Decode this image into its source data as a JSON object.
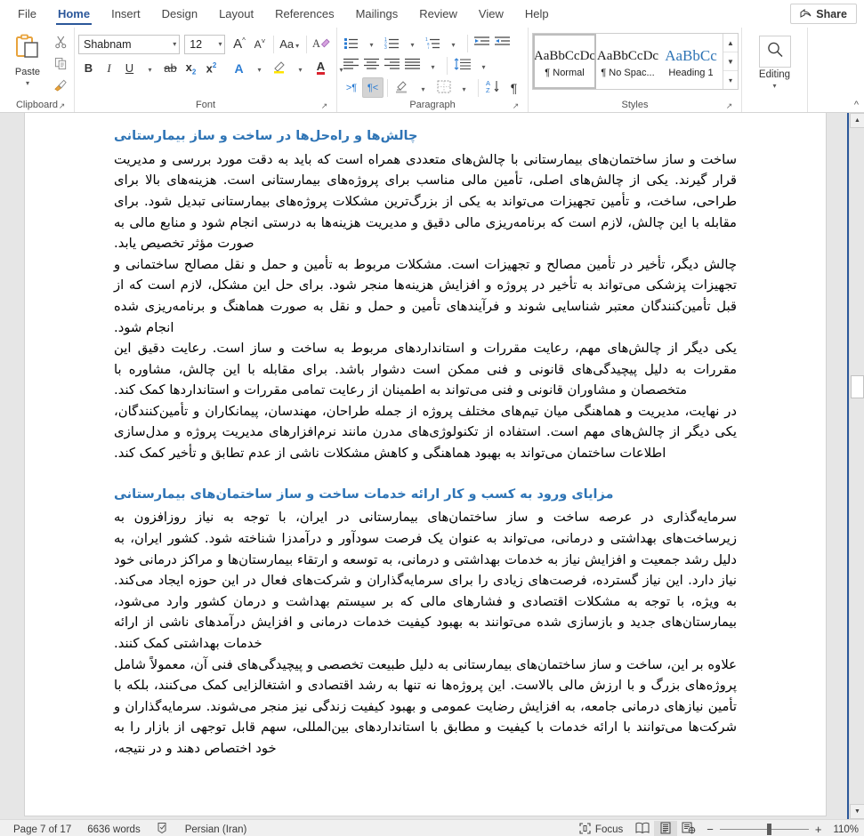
{
  "tabs": [
    {
      "label": "File",
      "active": false
    },
    {
      "label": "Home",
      "active": true
    },
    {
      "label": "Insert",
      "active": false
    },
    {
      "label": "Design",
      "active": false
    },
    {
      "label": "Layout",
      "active": false
    },
    {
      "label": "References",
      "active": false
    },
    {
      "label": "Mailings",
      "active": false
    },
    {
      "label": "Review",
      "active": false
    },
    {
      "label": "View",
      "active": false
    },
    {
      "label": "Help",
      "active": false
    }
  ],
  "share": {
    "label": "Share",
    "icon": "share-icon"
  },
  "ribbon": {
    "clipboard": {
      "group_label": "Clipboard",
      "paste_label": "Paste",
      "cut_icon": "scissors-icon",
      "copy_icon": "copy-icon",
      "format_painter_icon": "format-painter-icon"
    },
    "font": {
      "group_label": "Font",
      "font_name": "Shabnam",
      "font_size": "12",
      "grow_font_icon": "grow-font-icon",
      "shrink_font_icon": "shrink-font-icon",
      "change_case_label": "Aa",
      "clear_formatting_icon": "clear-formatting-icon",
      "bold_label": "B",
      "italic_label": "I",
      "underline_label": "U",
      "strikethrough_label": "ab",
      "subscript_label": "x",
      "superscript_label": "x",
      "text_effects_label": "A",
      "highlight_label": "highlight-icon",
      "font_color_label": "A"
    },
    "paragraph": {
      "group_label": "Paragraph",
      "bullets_icon": "bullets-icon",
      "numbering_icon": "numbering-icon",
      "multilevel_icon": "multilevel-list-icon",
      "decrease_indent_icon": "decrease-indent-icon",
      "increase_indent_icon": "increase-indent-icon",
      "align_left_icon": "align-left-icon",
      "align_center_icon": "align-center-icon",
      "align_right_icon": "align-right-icon",
      "justify_icon": "justify-icon",
      "line_spacing_icon": "line-spacing-icon",
      "ltr_label": ">¶",
      "rtl_label": "¶<",
      "shading_icon": "shading-icon",
      "borders_icon": "borders-icon",
      "sort_label": "AZ",
      "show_marks_label": "¶"
    },
    "styles": {
      "group_label": "Styles",
      "items": [
        {
          "preview": "AaBbCcDc",
          "name": "¶ Normal",
          "selected": true,
          "heading": false
        },
        {
          "preview": "AaBbCcDc",
          "name": "¶ No Spac...",
          "selected": false,
          "heading": false
        },
        {
          "preview": "AaBbCc",
          "name": "Heading 1",
          "selected": false,
          "heading": true
        }
      ]
    },
    "editing": {
      "group_label": "Editing",
      "label": "Editing",
      "icon": "magnifier-icon"
    },
    "collapse_icon": "chevron-up-icon"
  },
  "document": {
    "blocks": [
      {
        "type": "heading",
        "text": "چالش‌ها و راه‌حل‌ها در ساخت و ساز بیمارستانی"
      },
      {
        "type": "paragraph",
        "text": "ساخت و ساز ساختمان‌های بیمارستانی با چالش‌های متعددی همراه است که باید به دقت مورد بررسی و مدیریت قرار گیرند. یکی از چالش‌های اصلی، تأمین مالی مناسب برای پروژه‌های بیمارستانی است. هزینه‌های بالا برای طراحی، ساخت، و تأمین تجهیزات می‌تواند به یکی از بزرگ‌ترین مشکلات پروژه‌های بیمارستانی تبدیل شود. برای مقابله با این چالش، لازم است که برنامه‌ریزی مالی دقیق و مدیریت هزینه‌ها به درستی انجام شود و منابع مالی به صورت مؤثر تخصیص یابد."
      },
      {
        "type": "paragraph",
        "text": "چالش دیگر، تأخیر در تأمین مصالح و تجهیزات است. مشکلات مربوط به تأمین و حمل و نقل مصالح ساختمانی و تجهیزات پزشکی می‌تواند به تأخیر در پروژه و افزایش هزینه‌ها منجر شود. برای حل این مشکل، لازم است که از قبل تأمین‌کنندگان معتبر شناسایی شوند و فرآیندهای تأمین و حمل و نقل به صورت هماهنگ و برنامه‌ریزی شده انجام شود."
      },
      {
        "type": "paragraph",
        "text": "یکی دیگر از چالش‌های مهم، رعایت مقررات و استانداردهای مربوط به ساخت و ساز است. رعایت دقیق این مقررات به دلیل پیچیدگی‌های قانونی و فنی ممکن است دشوار باشد. برای مقابله با این چالش، مشاوره با متخصصان و مشاوران قانونی و فنی می‌تواند به اطمینان از رعایت تمامی مقررات و استانداردها کمک کند."
      },
      {
        "type": "paragraph",
        "text": "در نهایت، مدیریت و هماهنگی میان تیم‌های مختلف پروژه از جمله طراحان، مهندسان، پیمانکاران و تأمین‌کنندگان، یکی دیگر از چالش‌های مهم است. استفاده از تکنولوژی‌های مدرن مانند نرم‌افزارهای مدیریت پروژه و مدل‌سازی اطلاعات ساختمان می‌تواند به بهبود هماهنگی و کاهش مشکلات ناشی از عدم تطابق و تأخیر کمک کند."
      },
      {
        "type": "heading",
        "spaced": true,
        "text": "مزایای ورود به کسب و کار ارائه خدمات ساخت و ساز ساختمان‌های بیمارستانی"
      },
      {
        "type": "paragraph",
        "text": "سرمایه‌گذاری در عرصه ساخت و ساز ساختمان‌های بیمارستانی در ایران، با توجه به نیاز روزافزون به زیرساخت‌های بهداشتی و درمانی، می‌تواند به عنوان یک فرصت سودآور و درآمدزا شناخته شود. کشور ایران، به دلیل رشد جمعیت و افزایش نیاز به خدمات بهداشتی و درمانی، به توسعه و ارتقاء بیمارستان‌ها و مراکز درمانی خود نیاز دارد. این نیاز گسترده، فرصت‌های زیادی را برای سرمایه‌گذاران و شرکت‌های فعال در این حوزه ایجاد می‌کند. به ویژه، با توجه به مشکلات اقتصادی و فشارهای مالی که بر سیستم بهداشت و درمان کشور وارد می‌شود، بیمارستان‌های جدید و بازسازی شده می‌توانند به بهبود کیفیت خدمات درمانی و افزایش درآمدهای ناشی از ارائه خدمات بهداشتی کمک کنند."
      },
      {
        "type": "paragraph",
        "text": "علاوه بر این، ساخت و ساز ساختمان‌های بیمارستانی به دلیل طبیعت تخصصی و پیچیدگی‌های فنی آن، معمولاً شامل پروژه‌های بزرگ و با ارزش مالی بالاست. این پروژه‌ها نه تنها به رشد اقتصادی و اشتغالزایی کمک می‌کنند، بلکه با تأمین نیازهای درمانی جامعه، به افزایش رضایت عمومی و بهبود کیفیت زندگی نیز منجر می‌شوند. سرمایه‌گذاران و شرکت‌ها می‌توانند با ارائه خدمات با کیفیت و مطابق با استانداردهای بین‌المللی، سهم قابل توجهی از بازار را به خود اختصاص دهند و در نتیجه،"
      }
    ]
  },
  "statusbar": {
    "page_info": "Page 7 of 17",
    "word_count": "6636 words",
    "proofing_icon": "proofing-icon",
    "language": "Persian (Iran)",
    "focus_label": "Focus",
    "focus_icon": "focus-icon",
    "read_mode_icon": "read-mode-icon",
    "print_layout_icon": "print-layout-icon",
    "web_layout_icon": "web-layout-icon",
    "zoom_out_label": "−",
    "zoom_in_label": "+",
    "zoom_level": "110%"
  },
  "colors": {
    "accent": "#2b579a",
    "heading": "#2e74b5",
    "page_bg": "#e6e6e6"
  }
}
